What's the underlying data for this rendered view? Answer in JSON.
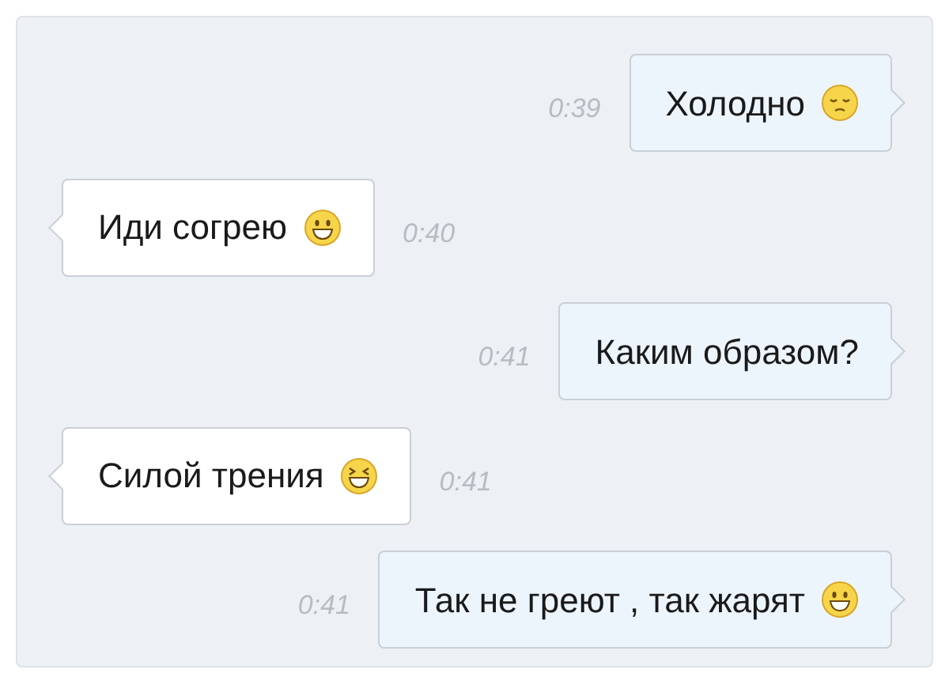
{
  "messages": [
    {
      "kind": "sent",
      "text": "Холодно",
      "emoji": {
        "kind": "pensive"
      },
      "time": "0:39"
    },
    {
      "kind": "received",
      "text": "Иди согрею",
      "emoji": {
        "kind": "grin"
      },
      "time": "0:40"
    },
    {
      "kind": "sent",
      "text": "Каким образом?",
      "time": "0:41"
    },
    {
      "kind": "received",
      "text": "Силой трения",
      "emoji": {
        "kind": "laugh"
      },
      "time": "0:41"
    },
    {
      "kind": "sent",
      "text": "Так не греют , так жарят",
      "emoji": {
        "kind": "grin"
      },
      "time": "0:41"
    }
  ]
}
